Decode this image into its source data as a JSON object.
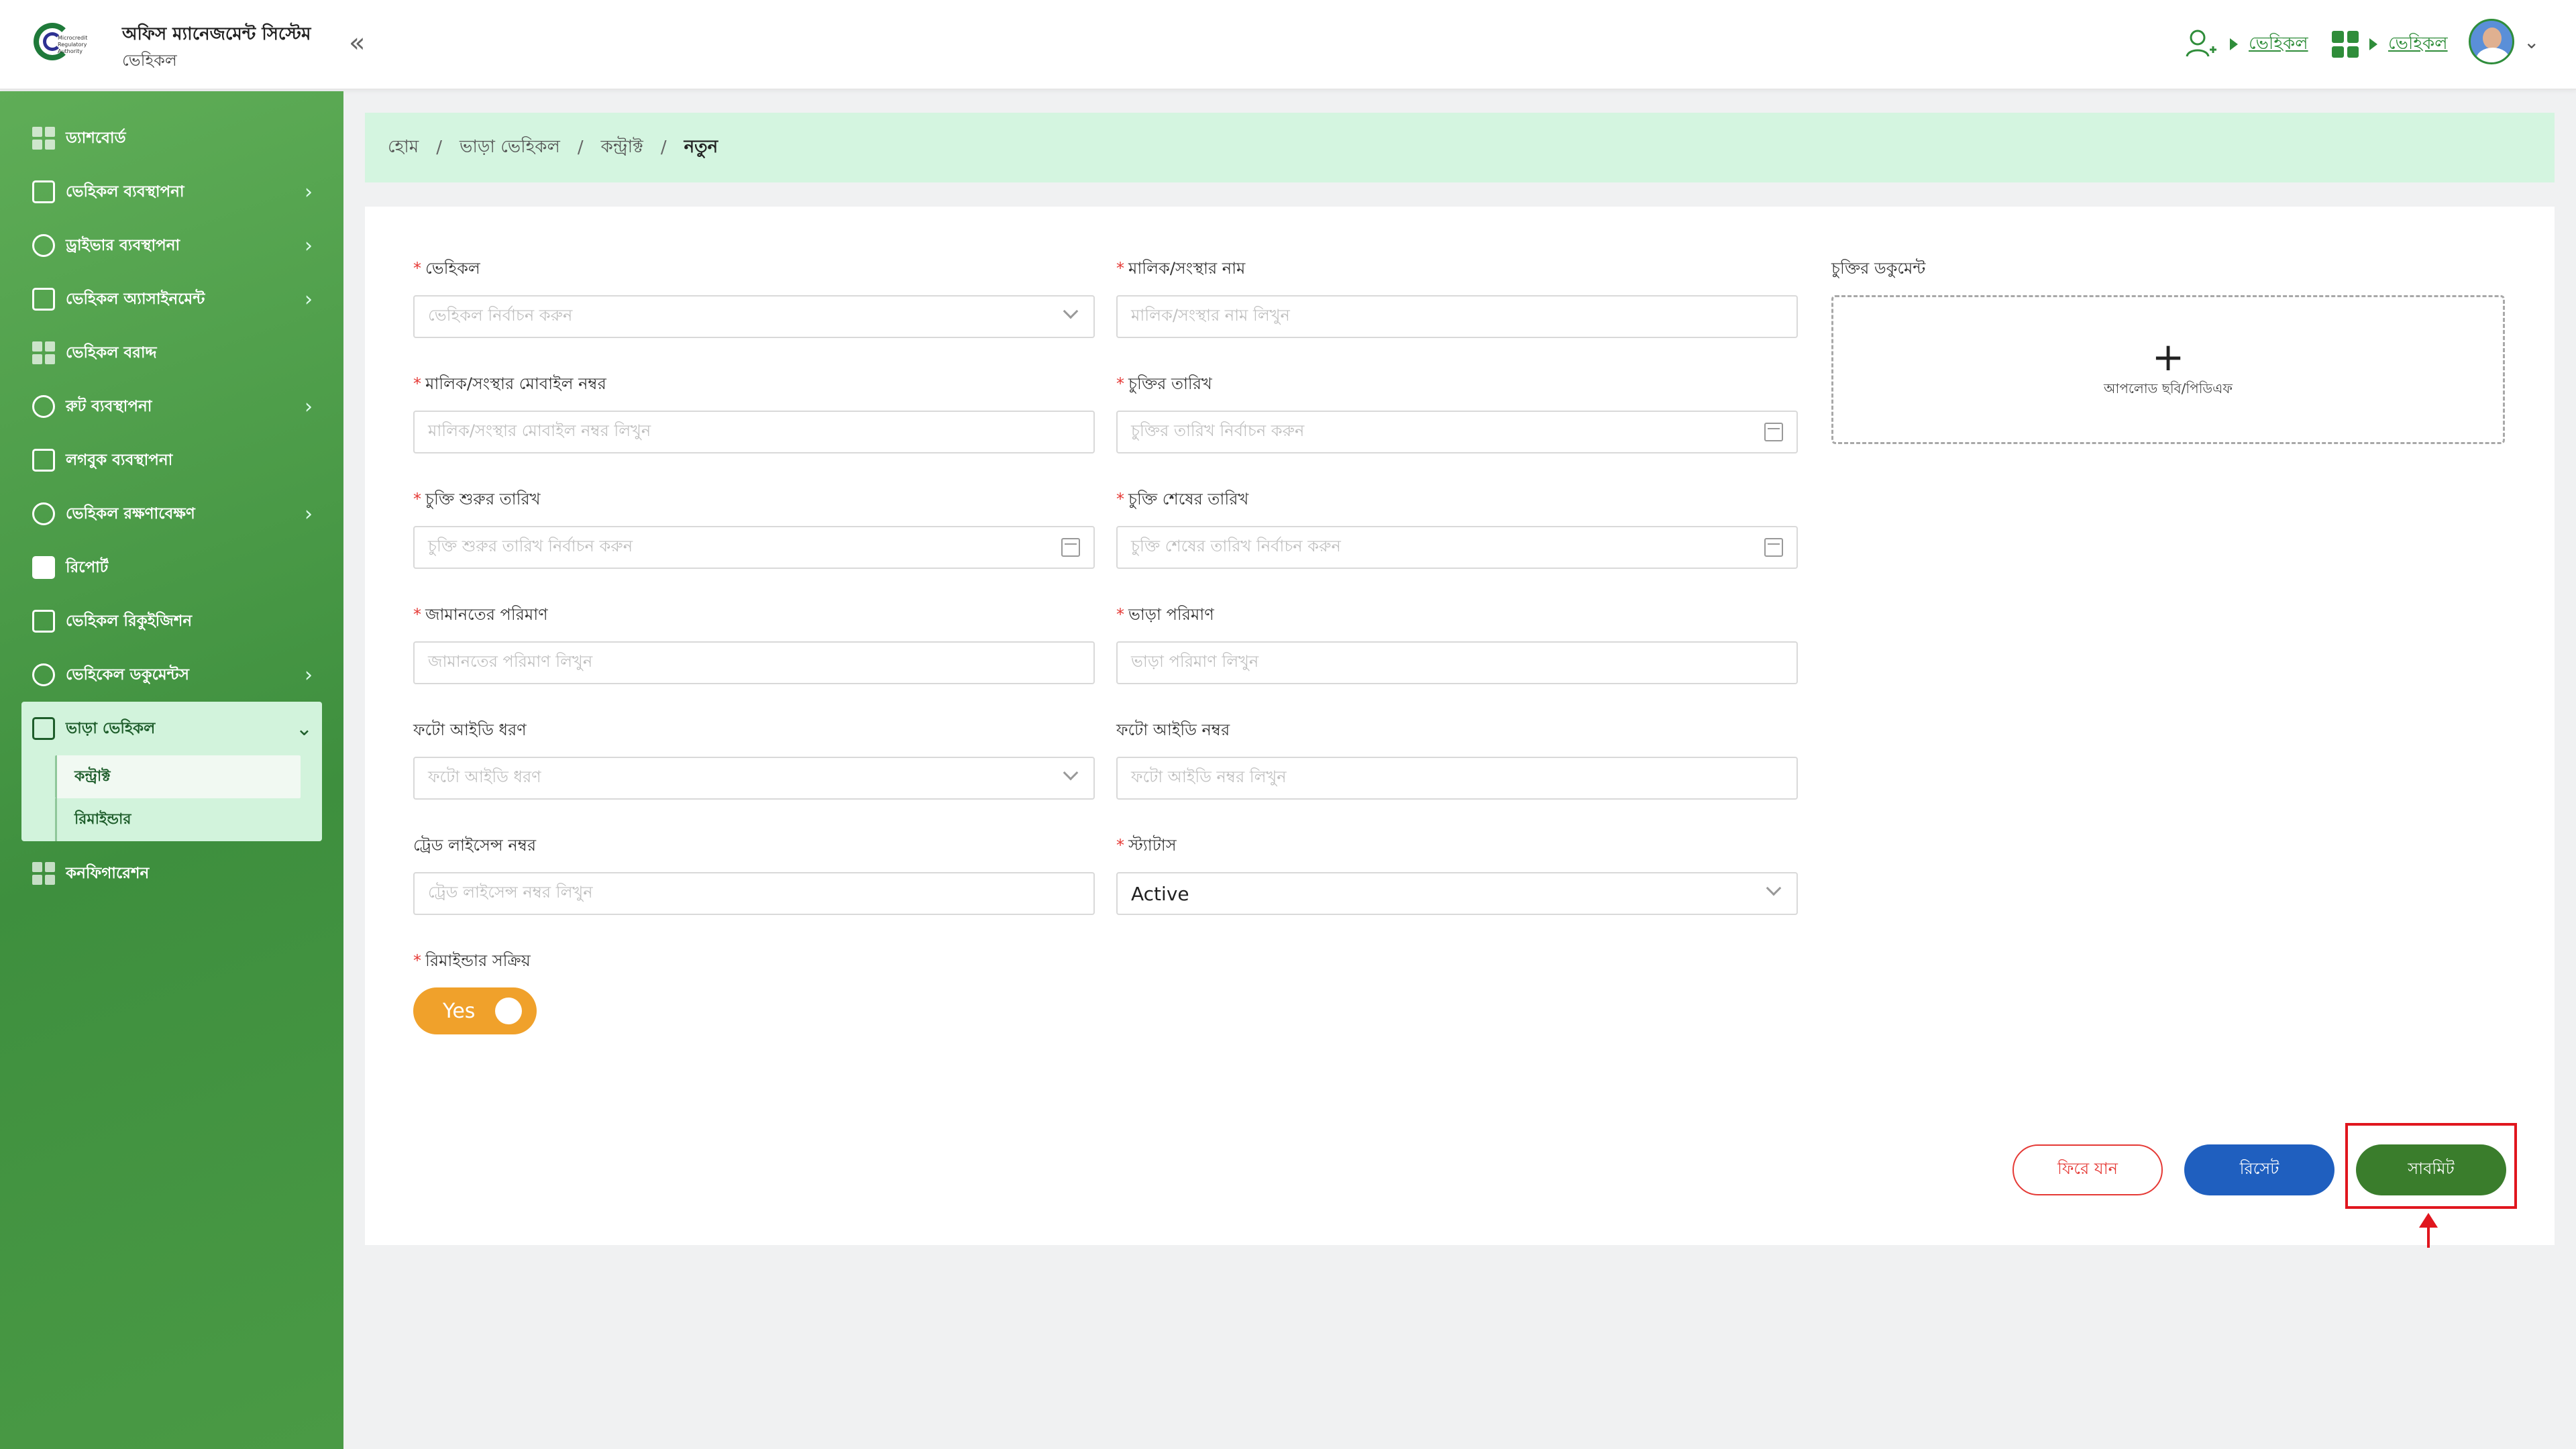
{
  "header": {
    "logo_text": "Microcredit Regulatory Authority",
    "app_title": "অফিস ম্যানেজমেন্ট সিস্টেম",
    "app_subtitle": "ভেহিকল",
    "collapse_icon": "«",
    "nav_link_1": "ভেহিকল",
    "nav_link_2": "ভেহিকল",
    "user_menu_chevron": "⌄"
  },
  "sidebar": {
    "items": [
      {
        "label": "ড্যাশবোর্ড",
        "icon": "dashboard-icon",
        "has_children": false
      },
      {
        "label": "ভেহিকল ব্যবস্থাপনা",
        "icon": "car-icon",
        "has_children": true
      },
      {
        "label": "ড্রাইভার ব্যবস্থাপনা",
        "icon": "driver-icon",
        "has_children": true
      },
      {
        "label": "ভেহিকল অ্যাসাইনমেন্ট",
        "icon": "assignment-icon",
        "has_children": true
      },
      {
        "label": "ভেহিকল বরাদ্দ",
        "icon": "allocation-icon",
        "has_children": false
      },
      {
        "label": "রুট ব্যবস্থাপনা",
        "icon": "route-icon",
        "has_children": true
      },
      {
        "label": "লগবুক ব্যবস্থাপনা",
        "icon": "logbook-icon",
        "has_children": false
      },
      {
        "label": "ভেহিকল রক্ষণাবেক্ষণ",
        "icon": "maintenance-icon",
        "has_children": true
      },
      {
        "label": "রিপোর্ট",
        "icon": "report-icon",
        "has_children": false
      },
      {
        "label": "ভেহিকল রিকুইজিশন",
        "icon": "requisition-icon",
        "has_children": false
      },
      {
        "label": "ভেহিকেল ডকুমেন্টস",
        "icon": "documents-icon",
        "has_children": true
      }
    ],
    "rental_group": {
      "label": "ভাড়া ভেহিকল",
      "children": [
        "কন্ট্রাক্ট",
        "রিমাইন্ডার"
      ],
      "active_child": "কন্ট্রাক্ট"
    },
    "config_label": "কনফিগারেশন",
    "arrow_right": "›",
    "arrow_down": "⌄"
  },
  "breadcrumb": {
    "items": [
      "হোম",
      "ভাড়া ভেহিকল",
      "কন্ট্রাক্ট",
      "নতুন"
    ],
    "separator": "/"
  },
  "form": {
    "vehicle": {
      "label": "ভেহিকল",
      "placeholder": "ভেহিকল নির্বাচন করুন",
      "required": true
    },
    "owner_name": {
      "label": "মালিক/সংস্থার নাম",
      "placeholder": "মালিক/সংস্থার নাম লিখুন",
      "required": true
    },
    "contract_document": {
      "label": "চুক্তির ডকুমেন্ট",
      "upload_text": "আপলোড ছবি/পিডিএফ",
      "plus": "+"
    },
    "owner_mobile": {
      "label": "মালিক/সংস্থার মোবাইল নম্বর",
      "placeholder": "মালিক/সংস্থার মোবাইল নম্বর লিখুন",
      "required": true
    },
    "contract_date": {
      "label": "চুক্তির তারিখ",
      "placeholder": "চুক্তির তারিখ নির্বাচন করুন",
      "required": true
    },
    "start_date": {
      "label": "চুক্তি শুরুর তারিখ",
      "placeholder": "চুক্তি শুরুর তারিখ নির্বাচন করুন",
      "required": true
    },
    "end_date": {
      "label": "চুক্তি শেষের তারিখ",
      "placeholder": "চুক্তি শেষের তারিখ নির্বাচন করুন",
      "required": true
    },
    "security_amount": {
      "label": "জামানতের পরিমাণ",
      "placeholder": "জামানতের পরিমাণ লিখুন",
      "required": true
    },
    "rent_amount": {
      "label": "ভাড়া পরিমাণ",
      "placeholder": "ভাড়া পরিমাণ লিখুন",
      "required": true
    },
    "photo_id_type": {
      "label": "ফটো আইডি ধরণ",
      "placeholder": "ফটো আইডি ধরণ",
      "required": false
    },
    "photo_id_number": {
      "label": "ফটো আইডি নম্বর",
      "placeholder": "ফটো আইডি নম্বর লিখুন",
      "required": false
    },
    "trade_license": {
      "label": "ট্রেড লাইসেন্স নম্বর",
      "placeholder": "ট্রেড লাইসেন্স নম্বর লিখুন",
      "required": false
    },
    "status": {
      "label": "স্ট্যাটাস",
      "value": "Active",
      "required": true
    },
    "reminder_active": {
      "label": "রিমাইন্ডার সক্রিয়",
      "value": "Yes",
      "required": true
    },
    "required_mark": "*"
  },
  "buttons": {
    "back": "ফিরে যান",
    "reset": "রিসেট",
    "submit": "সাবমিট"
  },
  "colors": {
    "accent_green": "#3a7d2c",
    "breadcrumb_bg": "#d4f5e0",
    "toggle_orange": "#f0a12b",
    "reset_blue": "#1f5fbf",
    "back_red": "#e53935",
    "highlight_red": "#e0161e"
  }
}
